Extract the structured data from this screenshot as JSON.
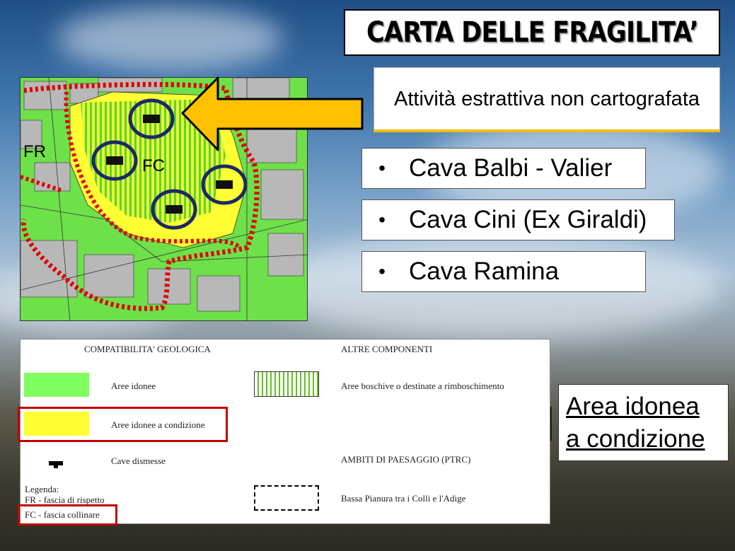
{
  "slide": {
    "title": "CARTA DELLE FRAGILITA’",
    "subtitle": "Attività estrattiva non cartografata",
    "cave_list": [
      {
        "bullet": "•",
        "name": "Cava Balbi - Valier"
      },
      {
        "bullet": "•",
        "name": "Cava Cini (Ex Giraldi)"
      },
      {
        "bullet": "•",
        "name": "Cava Ramina"
      }
    ],
    "callout": {
      "line1": "Area idonea",
      "line2": "a condizione"
    }
  },
  "map": {
    "labels": {
      "fr": "FR",
      "fc": "FC"
    }
  },
  "legend": {
    "section_geologica": "COMPATIBILITA' GEOLOGICA",
    "section_altre": "ALTRE COMPONENTI",
    "section_ambiti": "AMBITI DI PAESAGGIO (PTRC)",
    "items": {
      "aree_idonee": "Aree idonee",
      "aree_idonee_condizione": "Aree idonee a condizione",
      "cave_dismesse": "Cave dismesse",
      "aree_boschive": "Aree boschive o destinate a rimboschimento",
      "bassa_pianura": "Bassa Pianura tra i Colli e l'Adige"
    },
    "legenda": {
      "heading": "Legenda:",
      "fr": "FR - fascia di rispetto",
      "fc": "FC - fascia collinare"
    },
    "colors": {
      "idonee": "#80ff60",
      "condizione": "#ffff33",
      "highlight": "#c00000",
      "arrow_yellow": "#ffc000",
      "arrow_red": "#e00000"
    }
  }
}
